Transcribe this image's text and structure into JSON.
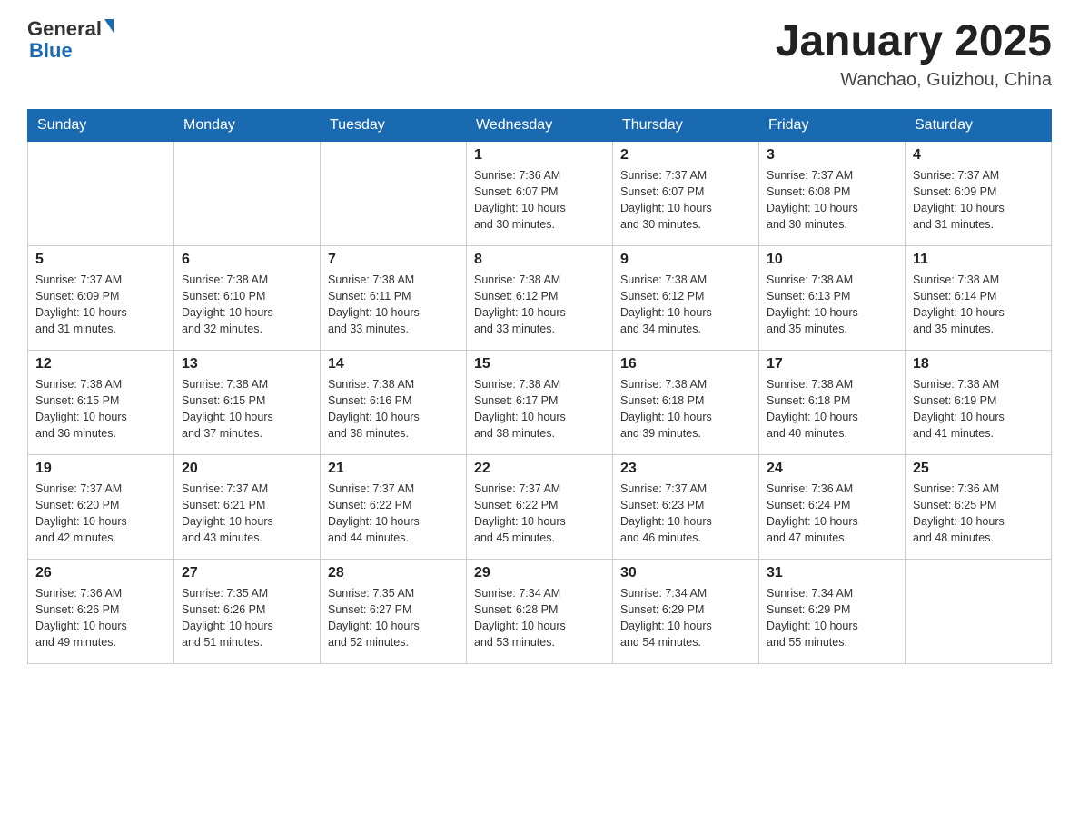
{
  "header": {
    "logo_general": "General",
    "logo_blue": "Blue",
    "month_title": "January 2025",
    "location": "Wanchao, Guizhou, China"
  },
  "days_of_week": [
    "Sunday",
    "Monday",
    "Tuesday",
    "Wednesday",
    "Thursday",
    "Friday",
    "Saturday"
  ],
  "weeks": [
    [
      {
        "day": "",
        "info": ""
      },
      {
        "day": "",
        "info": ""
      },
      {
        "day": "",
        "info": ""
      },
      {
        "day": "1",
        "info": "Sunrise: 7:36 AM\nSunset: 6:07 PM\nDaylight: 10 hours\nand 30 minutes."
      },
      {
        "day": "2",
        "info": "Sunrise: 7:37 AM\nSunset: 6:07 PM\nDaylight: 10 hours\nand 30 minutes."
      },
      {
        "day": "3",
        "info": "Sunrise: 7:37 AM\nSunset: 6:08 PM\nDaylight: 10 hours\nand 30 minutes."
      },
      {
        "day": "4",
        "info": "Sunrise: 7:37 AM\nSunset: 6:09 PM\nDaylight: 10 hours\nand 31 minutes."
      }
    ],
    [
      {
        "day": "5",
        "info": "Sunrise: 7:37 AM\nSunset: 6:09 PM\nDaylight: 10 hours\nand 31 minutes."
      },
      {
        "day": "6",
        "info": "Sunrise: 7:38 AM\nSunset: 6:10 PM\nDaylight: 10 hours\nand 32 minutes."
      },
      {
        "day": "7",
        "info": "Sunrise: 7:38 AM\nSunset: 6:11 PM\nDaylight: 10 hours\nand 33 minutes."
      },
      {
        "day": "8",
        "info": "Sunrise: 7:38 AM\nSunset: 6:12 PM\nDaylight: 10 hours\nand 33 minutes."
      },
      {
        "day": "9",
        "info": "Sunrise: 7:38 AM\nSunset: 6:12 PM\nDaylight: 10 hours\nand 34 minutes."
      },
      {
        "day": "10",
        "info": "Sunrise: 7:38 AM\nSunset: 6:13 PM\nDaylight: 10 hours\nand 35 minutes."
      },
      {
        "day": "11",
        "info": "Sunrise: 7:38 AM\nSunset: 6:14 PM\nDaylight: 10 hours\nand 35 minutes."
      }
    ],
    [
      {
        "day": "12",
        "info": "Sunrise: 7:38 AM\nSunset: 6:15 PM\nDaylight: 10 hours\nand 36 minutes."
      },
      {
        "day": "13",
        "info": "Sunrise: 7:38 AM\nSunset: 6:15 PM\nDaylight: 10 hours\nand 37 minutes."
      },
      {
        "day": "14",
        "info": "Sunrise: 7:38 AM\nSunset: 6:16 PM\nDaylight: 10 hours\nand 38 minutes."
      },
      {
        "day": "15",
        "info": "Sunrise: 7:38 AM\nSunset: 6:17 PM\nDaylight: 10 hours\nand 38 minutes."
      },
      {
        "day": "16",
        "info": "Sunrise: 7:38 AM\nSunset: 6:18 PM\nDaylight: 10 hours\nand 39 minutes."
      },
      {
        "day": "17",
        "info": "Sunrise: 7:38 AM\nSunset: 6:18 PM\nDaylight: 10 hours\nand 40 minutes."
      },
      {
        "day": "18",
        "info": "Sunrise: 7:38 AM\nSunset: 6:19 PM\nDaylight: 10 hours\nand 41 minutes."
      }
    ],
    [
      {
        "day": "19",
        "info": "Sunrise: 7:37 AM\nSunset: 6:20 PM\nDaylight: 10 hours\nand 42 minutes."
      },
      {
        "day": "20",
        "info": "Sunrise: 7:37 AM\nSunset: 6:21 PM\nDaylight: 10 hours\nand 43 minutes."
      },
      {
        "day": "21",
        "info": "Sunrise: 7:37 AM\nSunset: 6:22 PM\nDaylight: 10 hours\nand 44 minutes."
      },
      {
        "day": "22",
        "info": "Sunrise: 7:37 AM\nSunset: 6:22 PM\nDaylight: 10 hours\nand 45 minutes."
      },
      {
        "day": "23",
        "info": "Sunrise: 7:37 AM\nSunset: 6:23 PM\nDaylight: 10 hours\nand 46 minutes."
      },
      {
        "day": "24",
        "info": "Sunrise: 7:36 AM\nSunset: 6:24 PM\nDaylight: 10 hours\nand 47 minutes."
      },
      {
        "day": "25",
        "info": "Sunrise: 7:36 AM\nSunset: 6:25 PM\nDaylight: 10 hours\nand 48 minutes."
      }
    ],
    [
      {
        "day": "26",
        "info": "Sunrise: 7:36 AM\nSunset: 6:26 PM\nDaylight: 10 hours\nand 49 minutes."
      },
      {
        "day": "27",
        "info": "Sunrise: 7:35 AM\nSunset: 6:26 PM\nDaylight: 10 hours\nand 51 minutes."
      },
      {
        "day": "28",
        "info": "Sunrise: 7:35 AM\nSunset: 6:27 PM\nDaylight: 10 hours\nand 52 minutes."
      },
      {
        "day": "29",
        "info": "Sunrise: 7:34 AM\nSunset: 6:28 PM\nDaylight: 10 hours\nand 53 minutes."
      },
      {
        "day": "30",
        "info": "Sunrise: 7:34 AM\nSunset: 6:29 PM\nDaylight: 10 hours\nand 54 minutes."
      },
      {
        "day": "31",
        "info": "Sunrise: 7:34 AM\nSunset: 6:29 PM\nDaylight: 10 hours\nand 55 minutes."
      },
      {
        "day": "",
        "info": ""
      }
    ]
  ]
}
